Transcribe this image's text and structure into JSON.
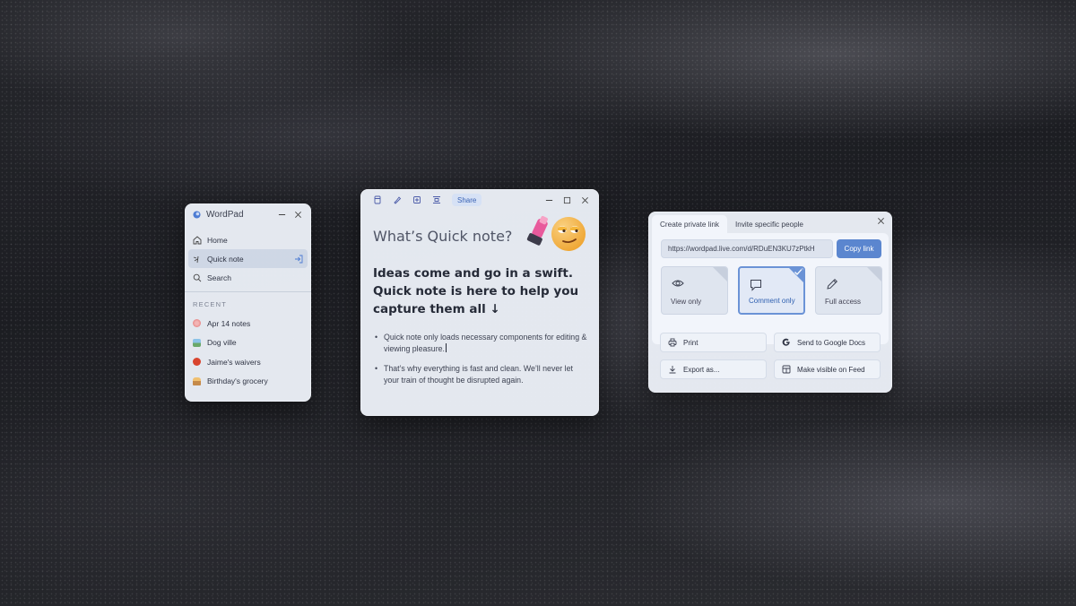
{
  "wordpad": {
    "title": "WordPad",
    "nav": [
      {
        "label": "Home",
        "icon": "home-icon"
      },
      {
        "label": "Quick note",
        "icon": "quick-note-icon",
        "active": true
      },
      {
        "label": "Search",
        "icon": "search-icon"
      }
    ],
    "recent_header": "RECENT",
    "recent": [
      {
        "label": "Apr 14 notes",
        "icon": "notes-emoji-icon",
        "color": "#e88a8a"
      },
      {
        "label": "Dog ville",
        "icon": "picture-icon",
        "color": "#6aa86a"
      },
      {
        "label": "Jaime's waivers",
        "icon": "red-circle-icon",
        "color": "#d9452f"
      },
      {
        "label": "Birthday's grocery",
        "icon": "cake-icon",
        "color": "#c58a4a"
      }
    ]
  },
  "quicknote": {
    "share_label": "Share",
    "heading": "What’s Quick note?",
    "lead": "Ideas come and go in a swift. Quick note is here to help you capture them all ↓",
    "bullets": [
      "Quick note only loads necessary components for editing & viewing pleasure.",
      "That’s why everything is fast and clean. We’ll never let your train of thought be disrupted again."
    ]
  },
  "share": {
    "tabs": [
      "Create private link",
      "Invite specific people"
    ],
    "link": "https://wordpad.live.com/d/RDuEN3KU7zPtkH",
    "copy_label": "Copy link",
    "permissions": [
      {
        "label": "View only",
        "icon": "eye-icon",
        "selected": false
      },
      {
        "label": "Comment only",
        "icon": "comment-icon",
        "selected": true
      },
      {
        "label": "Full access",
        "icon": "pencil-icon",
        "selected": false
      }
    ],
    "actions": [
      {
        "label": "Print",
        "icon": "printer-icon"
      },
      {
        "label": "Send to Google Docs",
        "icon": "google-icon"
      },
      {
        "label": "Export as...",
        "icon": "download-icon"
      },
      {
        "label": "Make visible on Feed",
        "icon": "feed-icon"
      }
    ],
    "accent": "#5b86cf"
  }
}
